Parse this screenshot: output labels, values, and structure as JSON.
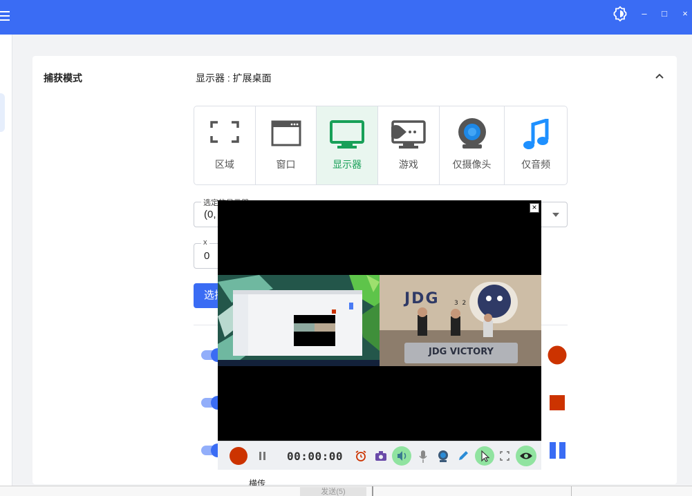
{
  "titlebar": {
    "color": "#3a6cf4",
    "icons": [
      "menu-icon",
      "theme-toggle-icon",
      "minimize-icon",
      "maximize-icon",
      "close-icon"
    ],
    "minimize_glyph": "–",
    "maximize_glyph": "□",
    "close_glyph": "×"
  },
  "capture": {
    "label": "捕获模式",
    "value": "显示器 : 扩展桌面",
    "modes": [
      {
        "label": "区域",
        "icon": "region-icon",
        "active": false
      },
      {
        "label": "窗口",
        "icon": "window-icon",
        "active": false
      },
      {
        "label": "显示器",
        "icon": "monitor-icon",
        "active": true
      },
      {
        "label": "游戏",
        "icon": "game-icon",
        "active": false
      },
      {
        "label": "仅摄像头",
        "icon": "webcam-icon",
        "active": false
      },
      {
        "label": "仅音频",
        "icon": "music-note-icon",
        "active": false
      }
    ],
    "selected_display_legend": "选定的显示器",
    "selected_display_value": "(0,",
    "x_legend": "x",
    "x_value": "0",
    "select_button_label": "选择"
  },
  "record_side_buttons": [
    "record-icon",
    "stop-icon",
    "pause-icon"
  ],
  "bottom_partial_label": "横传",
  "bottom_tab_label": "发送(5)",
  "preview": {
    "close_glyph": "×",
    "video_caption": "JDG VICTORY",
    "video_logo": "JDG",
    "video_score": "3  2",
    "timer": "00:00:00",
    "toolbar": [
      "record-button",
      "pause-button",
      "timer",
      "alarm-icon",
      "camera-icon",
      "speaker-icon",
      "mic-icon",
      "webcam-icon",
      "pen-icon",
      "cursor-icon",
      "fullscreen-icon",
      "eye-icon"
    ],
    "active_toggles": [
      "speaker",
      "cursor",
      "eye"
    ]
  },
  "colors": {
    "accent": "#3a6cf4",
    "active_mode": "#18a058",
    "record_red": "#cc3300",
    "toggle_on": "#90e3a0"
  }
}
